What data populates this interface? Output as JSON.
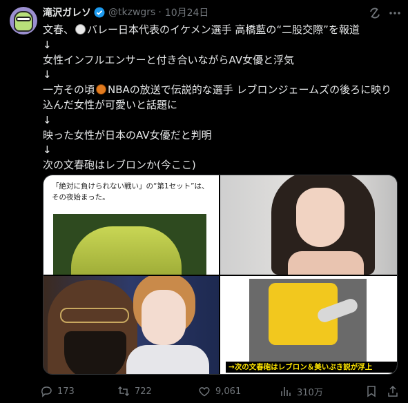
{
  "post": {
    "author_name": "滝沢ガレソ",
    "handle": "@tkzwgrs",
    "separator": "·",
    "date": "10月24日",
    "lines": [
      "文春、🏐バレー日本代表のイケメン選手 高橋藍の“二股交際”を報道",
      "↓",
      "女性インフルエンサーと付き合いながらAV女優と浮気",
      "↓",
      "一方その頃🏀NBAの放送で伝説的な選手 レブロンジェームズの後ろに映り",
      "込んだ女性が可愛いと話題に",
      "↓",
      "映った女性が日本のAV女優だと判明",
      "↓",
      "次の文春砲はレブロンか(今ここ)"
    ],
    "line1_pre": "文春、",
    "line1_post": "バレー日本代表のイケメン選手 高橋藍の“二股交際”を報道",
    "line5_pre": "一方その頃",
    "line5_post": "NBAの放送で伝説的な選手 レブロンジェームズの後ろに映り"
  },
  "media": {
    "image1_caption_line1": "「絶対に負けられない戦い」の“第1セット”は、",
    "image1_caption_line2": "その夜始まった。",
    "image4_banner": "→次の文春砲はレブロン＆美いぶき説が浮上"
  },
  "actions": {
    "replies": "173",
    "reposts": "722",
    "likes": "9,061",
    "views": "310万"
  },
  "icons": {
    "verified": "verified-badge-icon",
    "grok": "grok-icon",
    "more": "more-icon",
    "reply": "reply-icon",
    "repost": "repost-icon",
    "like": "heart-icon",
    "views": "views-chart-icon",
    "bookmark": "bookmark-icon",
    "share": "share-icon"
  },
  "colors": {
    "background": "#000000",
    "text": "#e7e9ea",
    "muted": "#71767b",
    "verified": "#1d9bf0",
    "banner_text": "#ffe600"
  }
}
